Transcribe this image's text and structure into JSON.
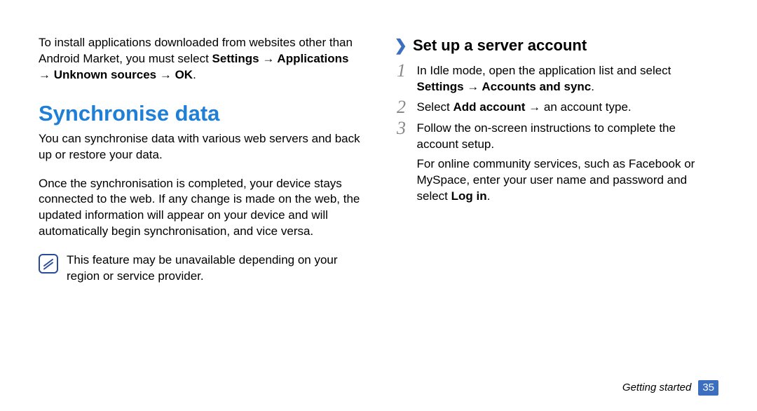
{
  "left": {
    "intro_full": "To install applications downloaded from websites other than Android Market, you must select Settings → Applications → Unknown sources → OK.",
    "intro_prefix": "To install applications downloaded from websites other than Android Market, you must select ",
    "intro_bold": "Settings → Applications → Unknown sources → OK",
    "intro_suffix": ".",
    "section_title": "Synchronise data",
    "para1": "You can synchronise data with various web servers and back up or restore your data.",
    "para2": "Once the synchronisation is completed, your device stays connected to the web. If any change is made on the web, the updated information will appear on your device and will automatically begin synchronisation, and vice versa.",
    "note": "This feature may be unavailable depending on your region or service provider."
  },
  "right": {
    "subhead": "Set up a server account",
    "steps": [
      {
        "num": "1",
        "prefix": "In Idle mode, open the application list and select ",
        "bold": "Settings → Accounts and sync",
        "suffix": "."
      },
      {
        "num": "2",
        "prefix": "Select ",
        "bold": "Add account",
        "suffix": " → an account type."
      },
      {
        "num": "3",
        "prefix": "Follow the on-screen instructions to complete the account setup.",
        "bold": "",
        "suffix": ""
      }
    ],
    "extra_prefix": "For online community services, such as Facebook or MySpace, enter your user name and password and select ",
    "extra_bold": "Log in",
    "extra_suffix": "."
  },
  "footer": {
    "section": "Getting started",
    "page": "35"
  },
  "icons": {
    "note": "note-icon",
    "chevron": "chevron-right-icon"
  }
}
